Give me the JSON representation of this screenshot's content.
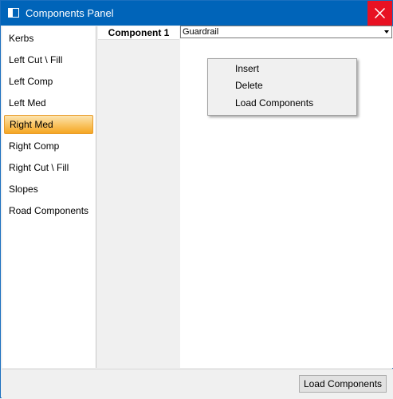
{
  "window": {
    "title": "Components Panel",
    "accent": "#0064b9",
    "close_color": "#e81123"
  },
  "sidebar": {
    "items": [
      {
        "label": "Kerbs"
      },
      {
        "label": "Left Cut \\ Fill"
      },
      {
        "label": "Left Comp"
      },
      {
        "label": "Left Med"
      },
      {
        "label": "Right Med",
        "selected": true
      },
      {
        "label": "Right Comp"
      },
      {
        "label": "Right Cut \\ Fill"
      },
      {
        "label": "Slopes"
      },
      {
        "label": "Road Components"
      }
    ]
  },
  "component": {
    "label": "Component 1",
    "value": "Guardrail"
  },
  "context_menu": {
    "items": [
      "Insert",
      "Delete",
      "Load Components"
    ]
  },
  "footer": {
    "load_button": "Load Components"
  }
}
